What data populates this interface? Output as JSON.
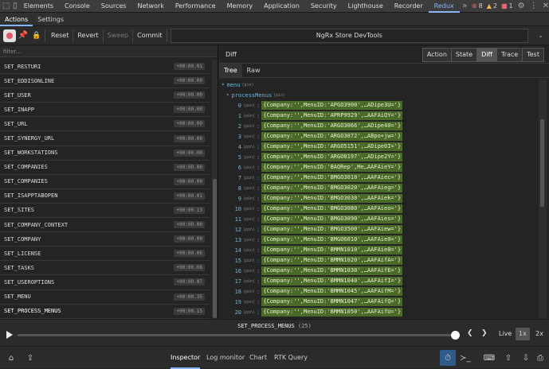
{
  "devtools": {
    "tabs": [
      "Elements",
      "Console",
      "Sources",
      "Network",
      "Performance",
      "Memory",
      "Application",
      "Security",
      "Lighthouse",
      "Recorder",
      "Redux"
    ],
    "active_tab": "Redux",
    "errors": "8",
    "warnings": "2",
    "issues": "1"
  },
  "subtabs": {
    "actions": "Actions",
    "settings": "Settings"
  },
  "toolbar": {
    "reset": "Reset",
    "revert": "Revert",
    "sweep": "Sweep",
    "commit": "Commit",
    "instance": "NgRx Store DevTools"
  },
  "filter": {
    "placeholder": "filter..."
  },
  "actions": [
    {
      "name": "SET_RESTURI",
      "time": "+00:00.01"
    },
    {
      "name": "SET_EDDISONLINE",
      "time": "+00:00.00"
    },
    {
      "name": "SET_USER",
      "time": "+00:00.00"
    },
    {
      "name": "SET_INAPP",
      "time": "+00:00.00"
    },
    {
      "name": "SET_URL",
      "time": "+00:00.00"
    },
    {
      "name": "SET_SYNERGY_URL",
      "time": "+00:00.00"
    },
    {
      "name": "SET_WORKSTATIONS",
      "time": "+00:00.00"
    },
    {
      "name": "SET_COMPANIES",
      "time": "+00:00.00"
    },
    {
      "name": "SET_COMPANIES",
      "time": "+00:00.00"
    },
    {
      "name": "SET_ISAPPTABOPEN",
      "time": "+00:00.01"
    },
    {
      "name": "SET_SITES",
      "time": "+00:00.13"
    },
    {
      "name": "SET_COMPANY_CONTEXT",
      "time": "+00:00.00"
    },
    {
      "name": "SET_COMPANY",
      "time": "+00:00.00"
    },
    {
      "name": "SET_LICENSE",
      "time": "+00:00.06"
    },
    {
      "name": "SET_TASKS",
      "time": "+00:00.08"
    },
    {
      "name": "SET_USEROPTIONS",
      "time": "+00:00.07"
    },
    {
      "name": "SET_MENU",
      "time": "+00:00.35"
    },
    {
      "name": "SET_PROCESS_MENUS",
      "time": "+00:00.15"
    }
  ],
  "inspector": {
    "title": "Diff",
    "modes": [
      "Action",
      "State",
      "Diff",
      "Trace",
      "Test"
    ],
    "active_mode": "Diff",
    "view_tabs": [
      "Tree",
      "Raw"
    ],
    "active_view": "Tree",
    "root_key": "menu",
    "child_key": "processMenus",
    "pin": "(pin)",
    "items": [
      {
        "i": "0",
        "v": "{Company:'',MenuID:'APGO3900',…ADipe3U='}"
      },
      {
        "i": "1",
        "v": "{Company:'',MenuID:'APRP9929',…AAFAiQY='}"
      },
      {
        "i": "2",
        "v": "{Company:'',MenuID:'ARGO3066',…ADipe40='}"
      },
      {
        "i": "3",
        "v": "{Company:'',MenuID:'ARGO3072',…ABpo+jw='}"
      },
      {
        "i": "4",
        "v": "{Company:'',MenuID:'ARGO5151',…ADipe0I='}"
      },
      {
        "i": "5",
        "v": "{Company:'',MenuID:'ARGO8197',…ADipe2Y='}"
      },
      {
        "i": "6",
        "v": "{Company:'',MenuID:'BAQRep',Me…AAFAieY='}"
      },
      {
        "i": "7",
        "v": "{Company:'',MenuID:'BMGO3010',…AAFAiec='}"
      },
      {
        "i": "8",
        "v": "{Company:'',MenuID:'BMGO3020',…AAFAieg='}"
      },
      {
        "i": "9",
        "v": "{Company:'',MenuID:'BMGO3030',…AAFAiek='}"
      },
      {
        "i": "10",
        "v": "{Company:'',MenuID:'BMGO3080',…AAFAieo='}"
      },
      {
        "i": "11",
        "v": "{Company:'',MenuID:'BMGO3090',…AAFAies='}"
      },
      {
        "i": "12",
        "v": "{Company:'',MenuID:'BMGO3500',…AAFAiew='}"
      },
      {
        "i": "13",
        "v": "{Company:'',MenuID:'BMGO6010',…AAFAie0='}"
      },
      {
        "i": "14",
        "v": "{Company:'',MenuID:'BMMN1010',…AAFAie8='}"
      },
      {
        "i": "15",
        "v": "{Company:'',MenuID:'BMMN1020',…AAFAifA='}"
      },
      {
        "i": "16",
        "v": "{Company:'',MenuID:'BMMN1030',…AAFAifE='}"
      },
      {
        "i": "17",
        "v": "{Company:'',MenuID:'BMMN1040',…AAFAifI='}"
      },
      {
        "i": "18",
        "v": "{Company:'',MenuID:'BMMN1045',…AAFAifM='}"
      },
      {
        "i": "19",
        "v": "{Company:'',MenuID:'BMMN1047',…AAFAifQ='}"
      },
      {
        "i": "20",
        "v": "{Company:'',MenuID:'BMMN1050',…AAFAifU='}"
      }
    ]
  },
  "slider": {
    "action": "SET_PROCESS_MENUS",
    "count": "(25)",
    "live": "Live",
    "speed1": "1x",
    "speed2": "2x"
  },
  "bottom_tabs": [
    "Inspector",
    "Log monitor",
    "Chart",
    "RTK Query"
  ],
  "active_bottom": "Inspector"
}
